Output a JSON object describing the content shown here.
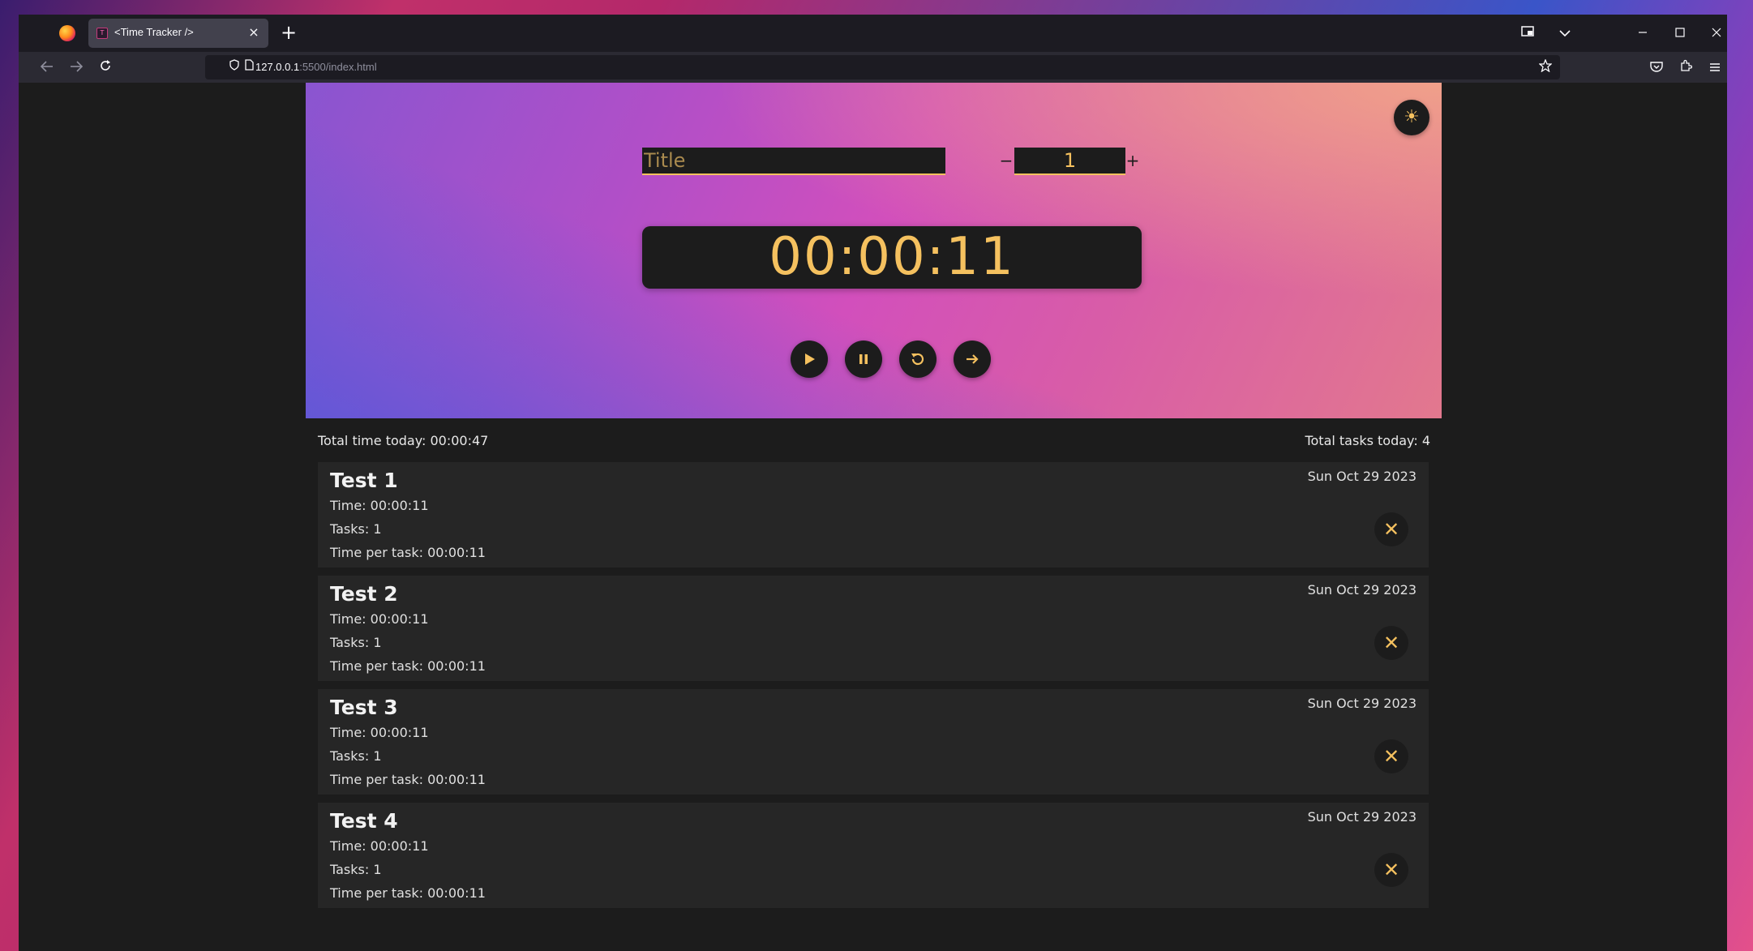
{
  "browser": {
    "tab_title": "<Time Tracker />",
    "tab_close": "×",
    "new_tab": "+",
    "url_host": "127.0.0.1",
    "url_rest": ":5500/index.html"
  },
  "timer": {
    "title_placeholder": "Title",
    "title_value": "",
    "task_count": "1",
    "minus_label": "−",
    "plus_label": "+",
    "clock": "00:00:11",
    "accent_color": "#f5c15f"
  },
  "summary": {
    "total_time": "Total time today: 00:00:47",
    "total_tasks": "Total tasks today: 4"
  },
  "entries": [
    {
      "title": "Test 1",
      "time": "Time: 00:00:11",
      "tasks": "Tasks: 1",
      "per_task": "Time per task: 00:00:11",
      "date": "Sun Oct 29 2023"
    },
    {
      "title": "Test 2",
      "time": "Time: 00:00:11",
      "tasks": "Tasks: 1",
      "per_task": "Time per task: 00:00:11",
      "date": "Sun Oct 29 2023"
    },
    {
      "title": "Test 3",
      "time": "Time: 00:00:11",
      "tasks": "Tasks: 1",
      "per_task": "Time per task: 00:00:11",
      "date": "Sun Oct 29 2023"
    },
    {
      "title": "Test 4",
      "time": "Time: 00:00:11",
      "tasks": "Tasks: 1",
      "per_task": "Time per task: 00:00:11",
      "date": "Sun Oct 29 2023"
    }
  ],
  "icons": {
    "delete": "✕",
    "theme": "☀"
  }
}
